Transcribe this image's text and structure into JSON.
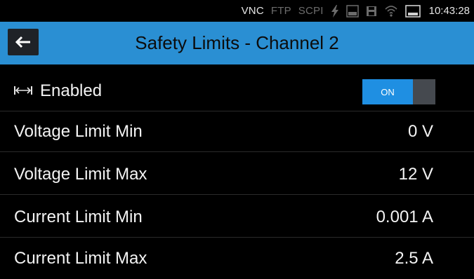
{
  "status": {
    "vnc": "VNC",
    "ftp": "FTP",
    "scpi": "SCPI",
    "clock": "10:43:28",
    "icons": [
      "lightning-icon",
      "log-icon",
      "save-icon",
      "wifi-icon",
      "screen-icon"
    ]
  },
  "header": {
    "title": "Safety Limits - Channel 2"
  },
  "enabled": {
    "label": "Enabled",
    "toggle": "ON"
  },
  "rows": [
    {
      "label": "Voltage Limit Min",
      "value": "0 V"
    },
    {
      "label": "Voltage Limit Max",
      "value": "12 V"
    },
    {
      "label": "Current Limit Min",
      "value": "0.001 A"
    },
    {
      "label": "Current Limit Max",
      "value": "2.5 A"
    }
  ],
  "colors": {
    "header": "#2a8fd3",
    "toggle_on": "#1f8fe2",
    "background": "#000000"
  }
}
